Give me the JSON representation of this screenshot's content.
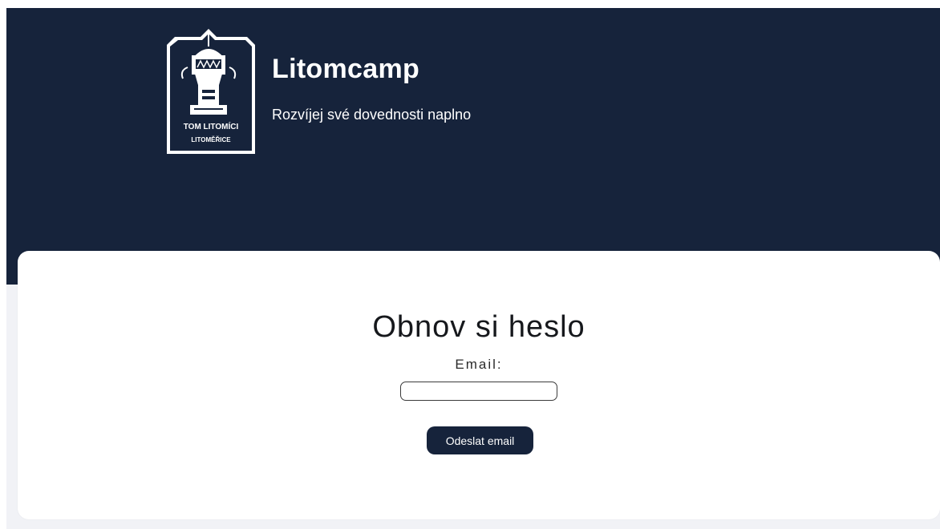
{
  "header": {
    "title": "Litomcamp",
    "subtitle": "Rozvíjej své dovednosti naplno",
    "logo": {
      "line1": "TOM LITOMÍCI",
      "line2": "LITOMĚŘICE",
      "icon": "tower-emblem-icon"
    }
  },
  "form": {
    "title": "Obnov si heslo",
    "email_label": "Email:",
    "email_value": "",
    "email_placeholder": "",
    "submit_label": "Odeslat email"
  },
  "colors": {
    "header_bg": "#16233b",
    "page_bg": "#f1f2f6",
    "card_bg": "#ffffff",
    "button_bg": "#16233b"
  }
}
